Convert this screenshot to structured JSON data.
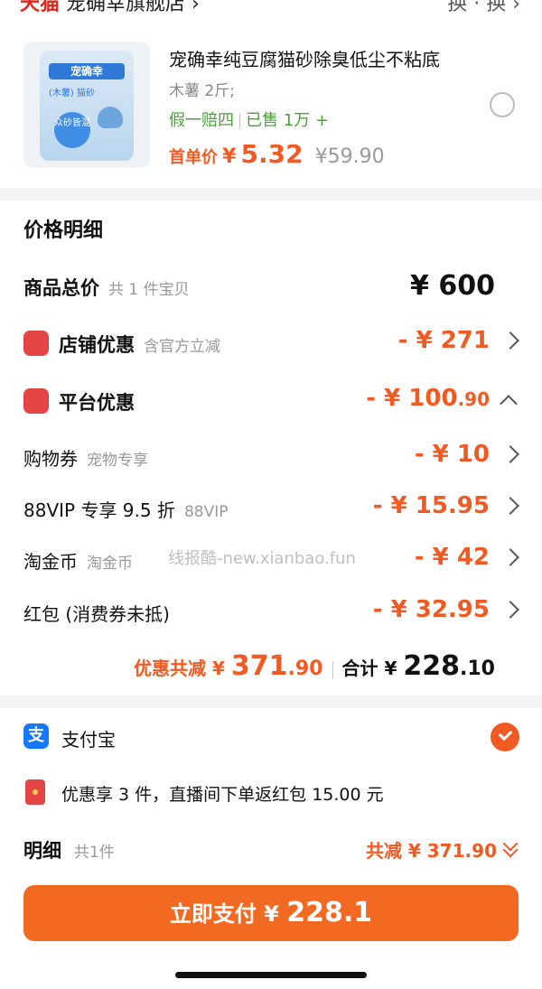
{
  "product": {
    "title": "宠确幸纯豆腐猫砂除臭低尘不粘底",
    "sku": "木薯 2斤;",
    "badge_guarantee": "假一赔四",
    "badge_sold": "已售 1万 +",
    "price_label": "首单价",
    "price_currency": "¥",
    "price": "5.32",
    "original_price": "¥59.90",
    "image_brand": "宠确幸",
    "image_tag": "(木薯) 猫砂",
    "image_circle": "众砂皆混"
  },
  "price_detail": {
    "title": "价格明细",
    "goods_total_label": "商品总价",
    "goods_total_sub": "共 1 件宝贝",
    "goods_total": "¥ 600",
    "store_discount_label": "店铺优惠",
    "store_discount_sub": "含官方立减",
    "store_discount": "- ¥ 271",
    "platform_discount_label": "平台优惠",
    "platform_discount_main": "- ¥ 100",
    "platform_discount_dec": ".90",
    "coupon_label": "购物券",
    "coupon_sub": "宠物专享",
    "coupon_amount": "- ¥ 10",
    "vip_label": "88VIP 专享 9.5 折",
    "vip_sub": "88VIP",
    "vip_amount": "- ¥ 15.95",
    "coin_label": "淘金币",
    "coin_sub": "淘金币",
    "coin_amount": "- ¥ 42",
    "redpack_label": "红包 (消费券未抵)",
    "redpack_amount": "- ¥ 32.95"
  },
  "watermark": "线报酷-new.xianbao.fun",
  "summary": {
    "discount_label": "优惠共减 ¥",
    "discount_main": "371",
    "discount_dec": ".90",
    "total_label": "合计 ¥",
    "total_main": "228",
    "total_dec": ".10"
  },
  "payment": {
    "method": "支付宝",
    "method_icon_glyph": "支",
    "promo": "优惠享 3 件，直播间下单返红包 15.00 元"
  },
  "detail": {
    "label": "明细",
    "count": "共1件",
    "total_reduction": "共减 ¥ 371.90"
  },
  "pay_button": {
    "label": "立即支付 ¥",
    "amount": "228.1"
  },
  "colors": {
    "accent": "#f15a22",
    "button": "#f26a21",
    "green": "#4aa23a",
    "alipay": "#1677ff"
  }
}
